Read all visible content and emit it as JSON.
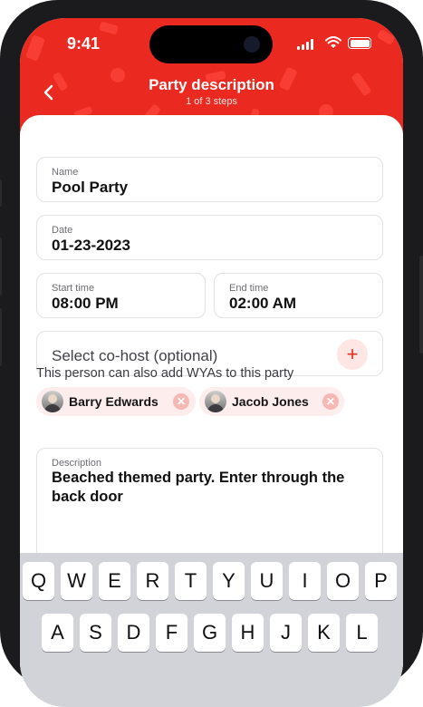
{
  "status": {
    "time": "9:41"
  },
  "header": {
    "title": "Party description",
    "subtitle": "1 of 3 steps"
  },
  "form": {
    "name": {
      "label": "Name",
      "value": "Pool Party"
    },
    "date": {
      "label": "Date",
      "value": "01-23-2023"
    },
    "start_time": {
      "label": "Start time",
      "value": "08:00 PM"
    },
    "end_time": {
      "label": "End time",
      "value": "02:00 AM"
    },
    "cohost": {
      "placeholder": "Select co-host (optional)",
      "add_symbol": "+"
    },
    "helper": "This person can also add WYAs to this party",
    "cohosts": [
      {
        "name": "Barry Edwards"
      },
      {
        "name": "Jacob Jones"
      }
    ],
    "description": {
      "label": "Description",
      "value": "Beached themed party. Enter through the back door"
    }
  },
  "keyboard": {
    "row1": [
      "Q",
      "W",
      "E",
      "R",
      "T",
      "Y",
      "U",
      "I",
      "O",
      "P"
    ],
    "row2": [
      "A",
      "S",
      "D",
      "F",
      "G",
      "H",
      "J",
      "K",
      "L"
    ]
  },
  "colors": {
    "accent": "#ea2a20",
    "chip_bg": "#fdeeed"
  },
  "icons": [
    "back-chevron-icon",
    "signal-icon",
    "wifi-icon",
    "battery-icon",
    "plus-icon",
    "remove-icon",
    "avatar"
  ]
}
